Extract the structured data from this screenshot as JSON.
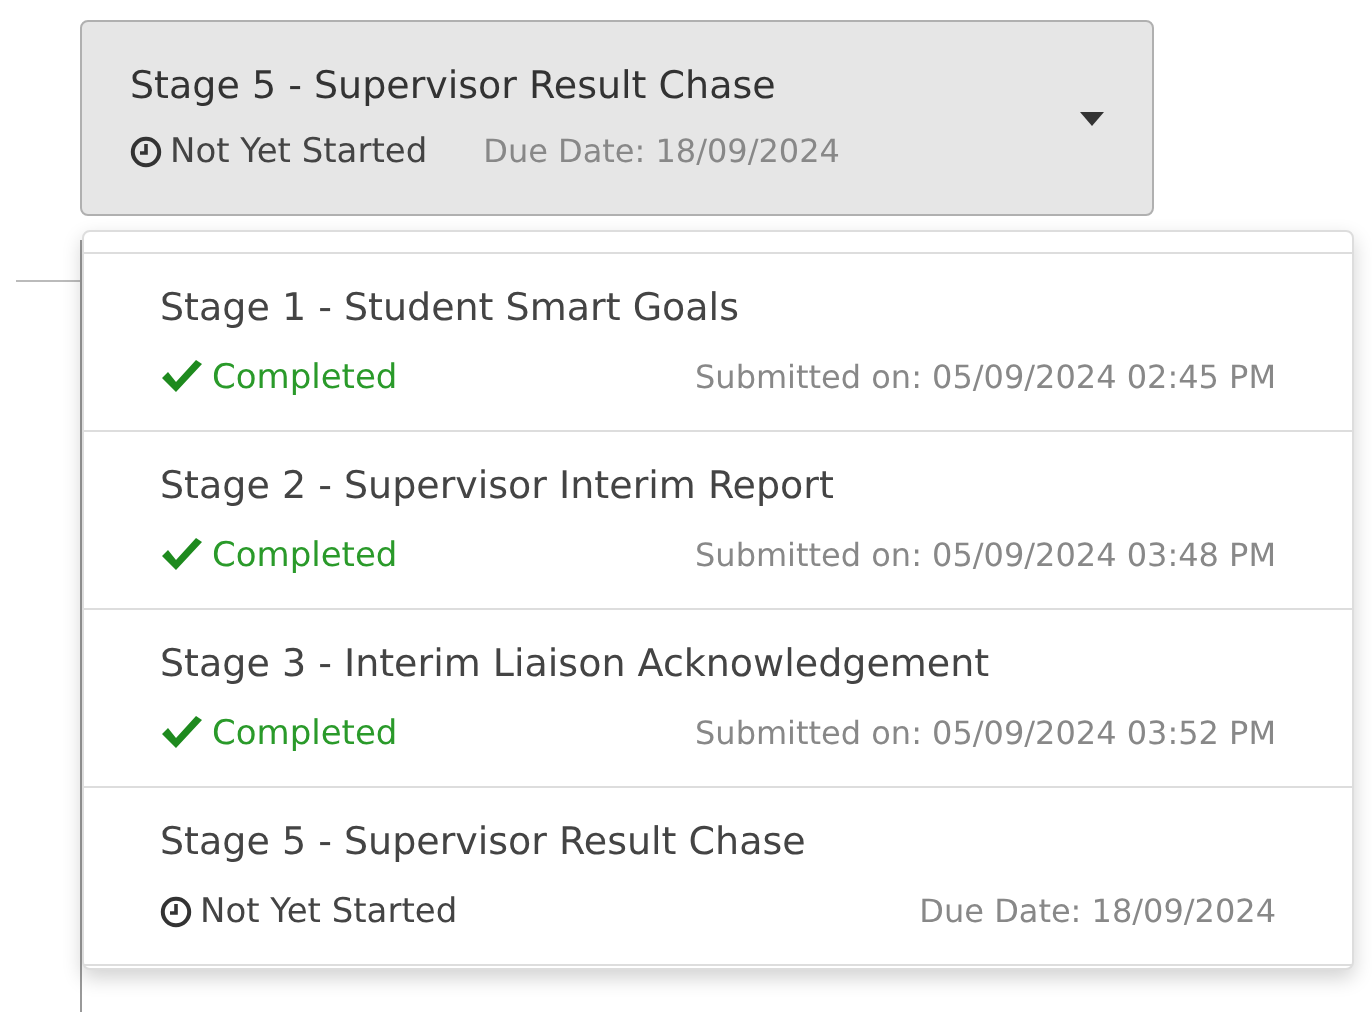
{
  "selector": {
    "title": "Stage 5 - Supervisor Result Chase",
    "status": {
      "kind": "not_started",
      "label": "Not Yet Started"
    },
    "date": "Due Date: 18/09/2024",
    "expanded": true
  },
  "options": [
    {
      "title": "Stage 1 - Student Smart Goals",
      "status": {
        "kind": "completed",
        "label": "Completed"
      },
      "date": "Submitted on: 05/09/2024 02:45 PM"
    },
    {
      "title": "Stage 2 - Supervisor Interim Report",
      "status": {
        "kind": "completed",
        "label": "Completed"
      },
      "date": "Submitted on: 05/09/2024 03:48 PM"
    },
    {
      "title": "Stage 3 - Interim Liaison Acknowledgement",
      "status": {
        "kind": "completed",
        "label": "Completed"
      },
      "date": "Submitted on: 05/09/2024 03:52 PM"
    },
    {
      "title": "Stage 5 - Supervisor Result Chase",
      "status": {
        "kind": "not_started",
        "label": "Not Yet Started"
      },
      "date": "Due Date: 18/09/2024"
    }
  ]
}
